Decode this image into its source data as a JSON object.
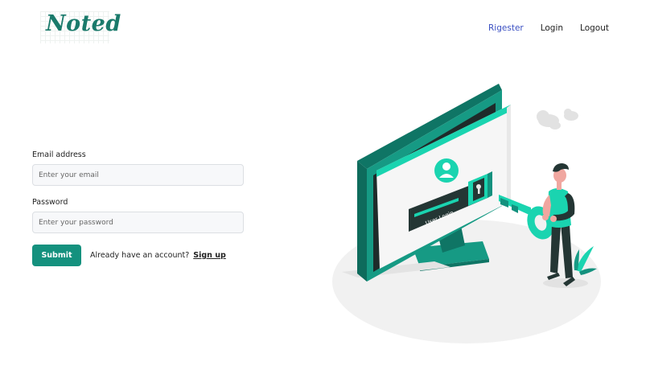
{
  "brand": {
    "logo_text": "Noted",
    "color": "#1a7a6b"
  },
  "nav": {
    "register": "Rigester",
    "login": "Login",
    "logout": "Logout",
    "active_color": "#3a4fc2"
  },
  "form": {
    "email_label": "Email address",
    "email_placeholder": "Enter your email",
    "email_value": "",
    "password_label": "Password",
    "password_placeholder": "Enter your password",
    "password_value": "",
    "submit_label": "Submit",
    "signup_prompt": "Already have an account?",
    "signup_link": "Sign up",
    "accent_color": "#14917e"
  },
  "illustration": {
    "screen_label": "User Login",
    "icons": [
      "monitor-illustration",
      "user-avatar-icon",
      "keyhole-icon",
      "key-icon",
      "person-figure",
      "cloud-icon",
      "plant-icon"
    ],
    "accent_color": "#1ad4b0"
  }
}
